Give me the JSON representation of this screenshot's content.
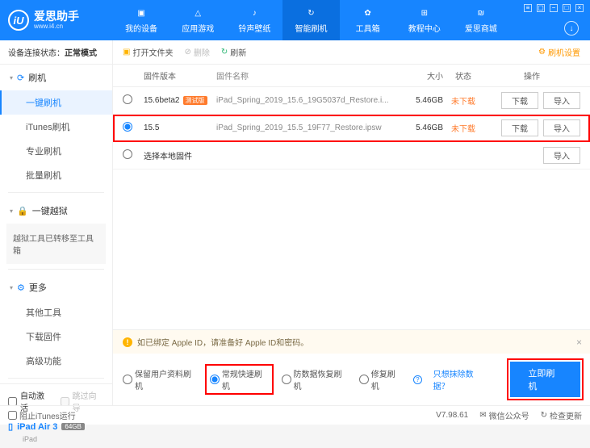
{
  "logo": {
    "title": "爱思助手",
    "sub": "www.i4.cn",
    "glyph": "iU"
  },
  "nav": [
    "我的设备",
    "应用游戏",
    "铃声壁纸",
    "智能刷机",
    "工具箱",
    "教程中心",
    "爱思商城"
  ],
  "nav_active": 3,
  "sidebar": {
    "status_label": "设备连接状态：",
    "status_value": "正常模式",
    "sections": [
      {
        "icon": "refresh",
        "label": "刷机",
        "items": [
          "一键刷机",
          "iTunes刷机",
          "专业刷机",
          "批量刷机"
        ],
        "active": 0
      },
      {
        "icon": "lock",
        "label": "一键越狱",
        "msg": "越狱工具已转移至工具箱"
      },
      {
        "icon": "gear",
        "label": "更多",
        "items": [
          "其他工具",
          "下载固件",
          "高级功能"
        ]
      }
    ],
    "auto_activate": "自动激活",
    "skip_guide": "跳过向导",
    "device_name": "iPad Air 3",
    "device_storage": "64GB",
    "device_type": "iPad"
  },
  "toolbar": {
    "open": "打开文件夹",
    "delete": "删除",
    "refresh": "刷新",
    "settings": "刷机设置"
  },
  "table": {
    "headers": {
      "ver": "固件版本",
      "name": "固件名称",
      "size": "大小",
      "status": "状态",
      "ops": "操作"
    },
    "rows": [
      {
        "ver": "15.6beta2",
        "tag": "测试版",
        "name": "iPad_Spring_2019_15.6_19G5037d_Restore.i...",
        "size": "5.46GB",
        "status": "未下载",
        "selected": false,
        "btns": [
          "下载",
          "导入"
        ]
      },
      {
        "ver": "15.5",
        "tag": "",
        "name": "iPad_Spring_2019_15.5_19F77_Restore.ipsw",
        "size": "5.46GB",
        "status": "未下载",
        "selected": true,
        "btns": [
          "下载",
          "导入"
        ]
      }
    ],
    "local": "选择本地固件",
    "local_btn": "导入"
  },
  "warning": "如已绑定 Apple ID，请准备好 Apple ID和密码。",
  "options": {
    "o1": "保留用户资料刷机",
    "o2": "常规快速刷机",
    "o3": "防数据恢复刷机",
    "o4": "修复刷机",
    "link": "只想抹除数据？",
    "go": "立即刷机"
  },
  "footer": {
    "block": "阻止iTunes运行",
    "ver": "V7.98.61",
    "wechat": "微信公众号",
    "update": "检查更新"
  }
}
